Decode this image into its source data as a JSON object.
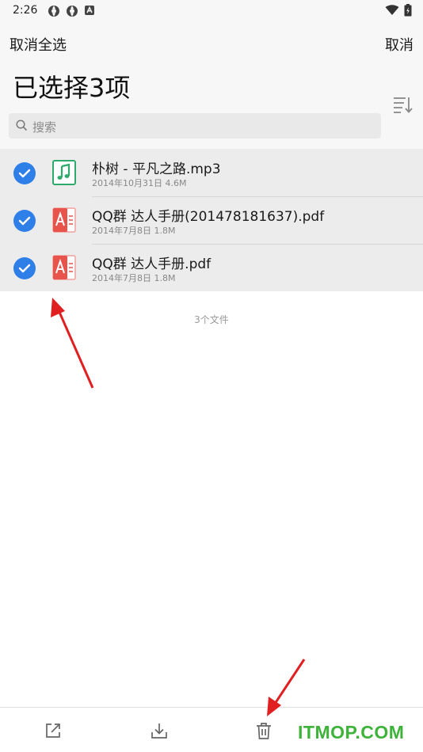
{
  "status_bar": {
    "time": "2:26"
  },
  "header": {
    "deselect_all_label": "取消全选",
    "cancel_label": "取消",
    "title": "已选择3项"
  },
  "search": {
    "placeholder": "搜索"
  },
  "files": [
    {
      "name": "朴树 - 平凡之路.mp3",
      "meta": "2014年10月31日  4.6M",
      "type": "music-file-icon",
      "selected": true
    },
    {
      "name": "QQ群 达人手册(201478181637).pdf",
      "meta": "2014年7月8日  1.8M",
      "type": "pdf-file-icon",
      "selected": true
    },
    {
      "name": "QQ群 达人手册.pdf",
      "meta": "2014年7月8日  1.8M",
      "type": "pdf-file-icon",
      "selected": true
    }
  ],
  "file_count": "3个文件",
  "bottom_bar": {
    "actions": [
      "share-icon",
      "download-icon",
      "delete-icon"
    ]
  },
  "watermark": "ITMOP.COM",
  "colors": {
    "accent": "#2f7fe9",
    "music_icon": "#2eaa6c",
    "pdf_icon": "#e8534b",
    "annotation_arrow": "#e02020",
    "watermark": "#3db339"
  }
}
